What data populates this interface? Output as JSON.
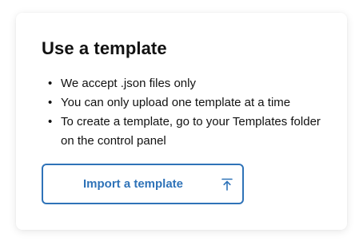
{
  "card": {
    "title": "Use a template",
    "bullets": [
      {
        "symbol": "•",
        "text": "We accept .json files only"
      },
      {
        "symbol": "•",
        "text": "You can only upload one template at a time"
      },
      {
        "symbol": "•",
        "text": "To create a template, go to your Templates folder on the control panel"
      }
    ],
    "import_button": {
      "label": "Import a template",
      "icon": "upload-icon"
    }
  },
  "colors": {
    "accent": "#2f73b8",
    "text": "#111111",
    "card_background": "#ffffff"
  }
}
